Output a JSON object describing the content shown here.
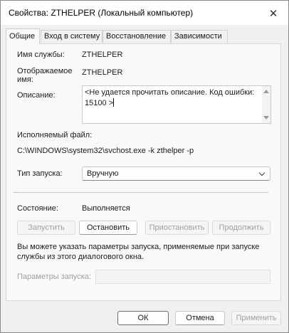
{
  "window": {
    "title": "Свойства: ZTHELPER (Локальный компьютер)"
  },
  "tabs": [
    {
      "label": "Общие",
      "active": true
    },
    {
      "label": "Вход в систему"
    },
    {
      "label": "Восстановление"
    },
    {
      "label": "Зависимости"
    }
  ],
  "general": {
    "service_name_label": "Имя службы:",
    "service_name": "ZTHELPER",
    "display_name_label_1": "Отображаемое",
    "display_name_label_2": "имя:",
    "display_name": "ZTHELPER",
    "description_label": "Описание:",
    "description": "<Не удается прочитать описание. Код ошибки: 15100 >",
    "exe_label": "Исполняемый файл:",
    "exe_path": "C:\\WINDOWS\\system32\\svchost.exe -k zthelper -p",
    "startup_type_label": "Тип запуска:",
    "startup_type": "Вручную",
    "status_label": "Состояние:",
    "status": "Выполняется",
    "buttons": {
      "start": "Запустить",
      "stop": "Остановить",
      "pause": "Приостановить",
      "resume": "Продолжить"
    },
    "hint_1": "Вы можете указать параметры запуска, применяемые при запуске",
    "hint_2": "службы из этого диалогового окна.",
    "params_label": "Параметры запуска:",
    "params_value": ""
  },
  "footer": {
    "ok": "ОК",
    "cancel": "Отмена",
    "apply": "Применить"
  }
}
